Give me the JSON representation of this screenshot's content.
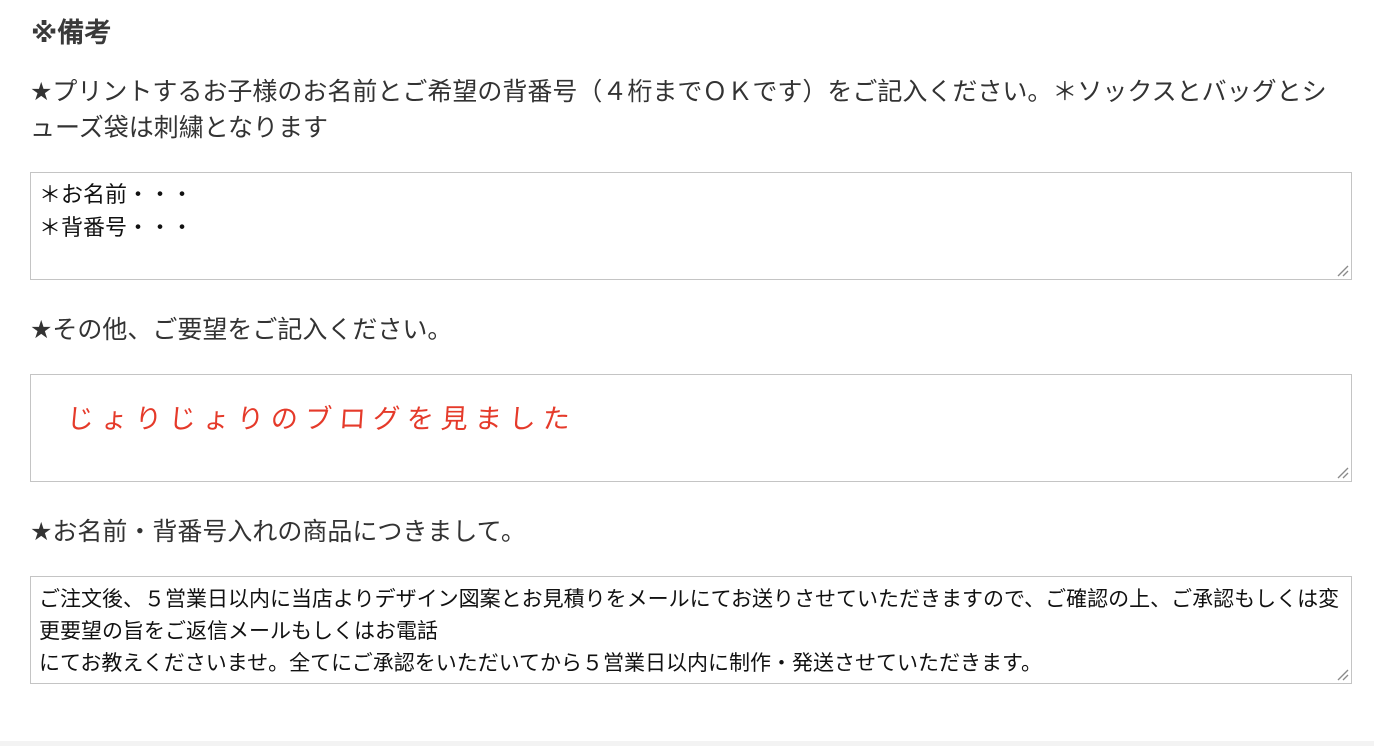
{
  "remarks": {
    "title": "※備考"
  },
  "print_name": {
    "label": "★プリントするお子様のお名前とご希望の背番号（４桁までＯＫです）をご記入ください。＊ソックスとバッグとシューズ袋は刺繍となります",
    "value": "＊お名前・・・\n＊背番号・・・"
  },
  "other_requests": {
    "label": "★その他、ご要望をご記入ください。",
    "value": "じょりじょりのブログを見ました",
    "value_color": "#e53a2a"
  },
  "name_number_notice": {
    "label": "★お名前・背番号入れの商品につきまして。",
    "value": "ご注文後、５営業日以内に当店よりデザイン図案とお見積りをメールにてお送りさせていただきますので、ご確認の上、ご承認もしくは変更要望の旨をご返信メールもしくはお電話\nにてお教えくださいませ。全てにご承認をいただいてから５営業日以内に制作・発送させていただきます。"
  },
  "icons": {
    "resize": "resize-grip-icon"
  }
}
